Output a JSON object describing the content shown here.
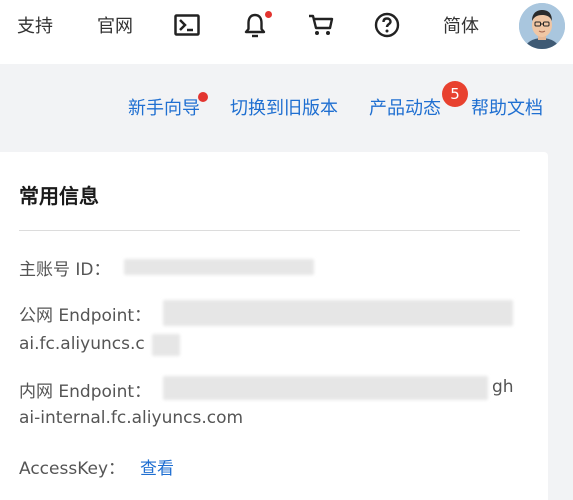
{
  "topbar": {
    "support_label": "支持",
    "official_label": "官网",
    "terminal_icon": "terminal-icon",
    "bell_icon": "bell-icon",
    "cart_icon": "cart-icon",
    "help_icon": "help-icon",
    "language_label": "简体",
    "avatar": "avatar"
  },
  "links": {
    "guide": "新手向导",
    "switch_old": "切换到旧版本",
    "product_news": "产品动态",
    "product_news_badge": "5",
    "help_docs": "帮助文档"
  },
  "card": {
    "title": "常用信息",
    "account_label": "主账号 ID：",
    "public_endpoint_label": "公网 Endpoint：",
    "public_endpoint_tail": "ai.fc.aliyuncs.c",
    "internal_endpoint_label": "内网 Endpoint：",
    "internal_endpoint_end": "gh",
    "internal_endpoint_tail": "ai-internal.fc.aliyuncs.com",
    "accesskey_label": "AccessKey：",
    "accesskey_link": "查看"
  },
  "colors": {
    "link": "#1f6fd1",
    "badge": "#e8412f",
    "background": "#f2f3f5"
  }
}
